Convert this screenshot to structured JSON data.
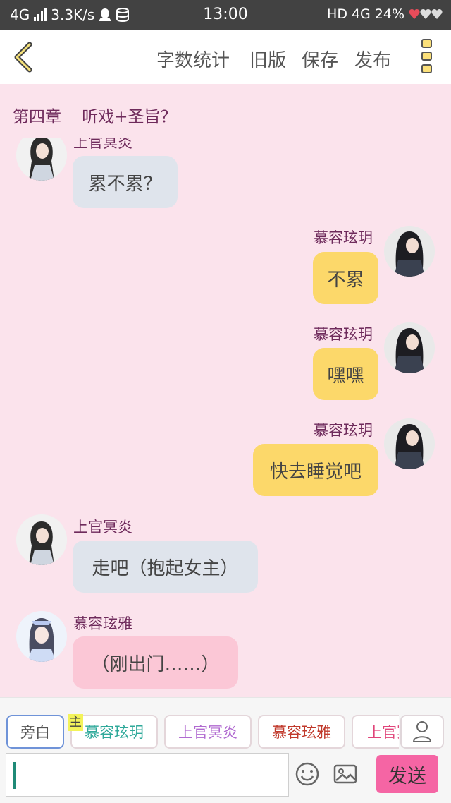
{
  "status_bar": {
    "network_left": "4G",
    "speed": "3.3K/s",
    "time": "13:00",
    "hd": "HD",
    "network_right": "4G",
    "battery": "24%"
  },
  "toolbar": {
    "word_count": "字数统计",
    "old_version": "旧版",
    "save": "保存",
    "publish": "发布"
  },
  "chapter": {
    "number": "第四章",
    "title": "听戏+圣旨？"
  },
  "messages": [
    {
      "speaker": "上官冥炎",
      "text": "累不累？",
      "side": "left"
    },
    {
      "speaker": "慕容玹玥",
      "text": "不累",
      "side": "right"
    },
    {
      "speaker": "慕容玹玥",
      "text": "嘿嘿",
      "side": "right"
    },
    {
      "speaker": "慕容玹玥",
      "text": "快去睡觉吧",
      "side": "right"
    },
    {
      "speaker": "上官冥炎",
      "text": "走吧（抱起女主）",
      "side": "left"
    },
    {
      "speaker": "慕容玹雅",
      "text": "（刚出门……）",
      "side": "left"
    }
  ],
  "roles": [
    {
      "label": "旁白",
      "color": "#555555",
      "selected": true
    },
    {
      "label": "慕容玹玥",
      "color": "#2fa99a"
    },
    {
      "label": "上官冥炎",
      "color": "#b06ad0"
    },
    {
      "label": "慕容玹雅",
      "color": "#c0392b"
    },
    {
      "label": "上官冥炎",
      "color": "#e0457a"
    }
  ],
  "protagonist_mark": "主",
  "input": {
    "value": ""
  },
  "send_label": "发送",
  "colors": {
    "accent_pink": "#f565a4",
    "bubble_yellow": "#fcd86a",
    "chat_bg": "#fbe3ec",
    "name_purple": "#6e2a5b"
  }
}
